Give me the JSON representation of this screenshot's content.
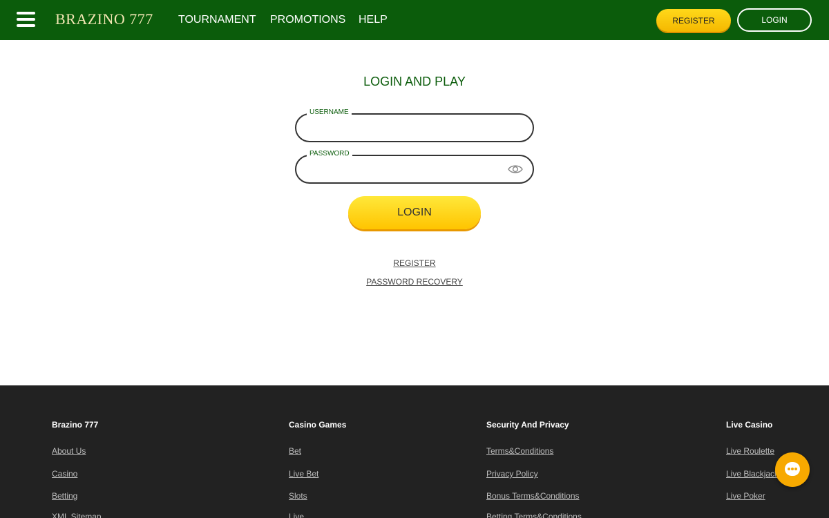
{
  "header": {
    "logo": "BRAZINO 777",
    "nav": [
      "TOURNAMENT",
      "PROMOTIONS",
      "HELP"
    ],
    "register_label": "REGISTER",
    "login_label": "LOGIN"
  },
  "login_form": {
    "title": "LOGIN AND PLAY",
    "username_label": "USERNAME",
    "username_value": "",
    "password_label": "PASSWORD",
    "password_value": "",
    "submit_label": "LOGIN",
    "register_link": "REGISTER",
    "recovery_link": "PASSWORD RECOVERY"
  },
  "footer": {
    "columns": [
      {
        "title": "Brazino 777",
        "links": [
          "About Us",
          "Casino",
          "Betting",
          "XML Sitemap"
        ]
      },
      {
        "title": "Casino Games",
        "links": [
          "Bet",
          "Live Bet",
          "Slots",
          "Live"
        ]
      },
      {
        "title": "Security And Privacy",
        "links": [
          "Terms&Conditions",
          "Privacy Policy",
          "Bonus Terms&Conditions",
          "Betting Terms&Conditions"
        ]
      },
      {
        "title": "Live Casino",
        "links": [
          "Live Roulette",
          "Live Blackjack",
          "Live Poker"
        ]
      }
    ]
  },
  "colors": {
    "header_bg": "#0b5c0b",
    "accent_yellow": "#ffc400",
    "footer_bg": "#222222",
    "chat_button": "#f7a900"
  },
  "icons": {
    "menu": "hamburger-menu-icon",
    "password_toggle": "eye-icon",
    "chat": "chat-bubble-icon"
  }
}
